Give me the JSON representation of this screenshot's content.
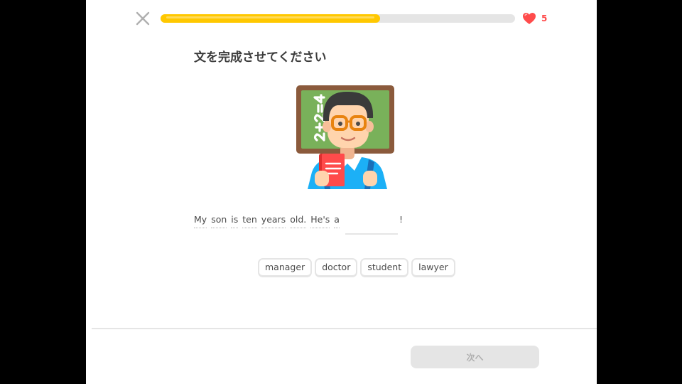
{
  "header": {
    "progress_fraction": 0.62,
    "hearts_count": "5"
  },
  "prompt": {
    "title": "文を完成させてください"
  },
  "sentence": {
    "words": [
      "My",
      "son",
      "is",
      "ten",
      "years",
      "old.",
      "He's",
      "a"
    ],
    "ending": "!"
  },
  "choices": [
    "manager",
    "doctor",
    "student",
    "lawyer"
  ],
  "footer": {
    "next_label": "次へ"
  },
  "colors": {
    "progress": "#ffc800",
    "heart": "#ff4b4b",
    "disabled_button": "#e5e5e5"
  },
  "icons": {
    "close": "close-icon",
    "heart": "heart-icon",
    "illustration": "teacher-chalkboard-illustration"
  }
}
